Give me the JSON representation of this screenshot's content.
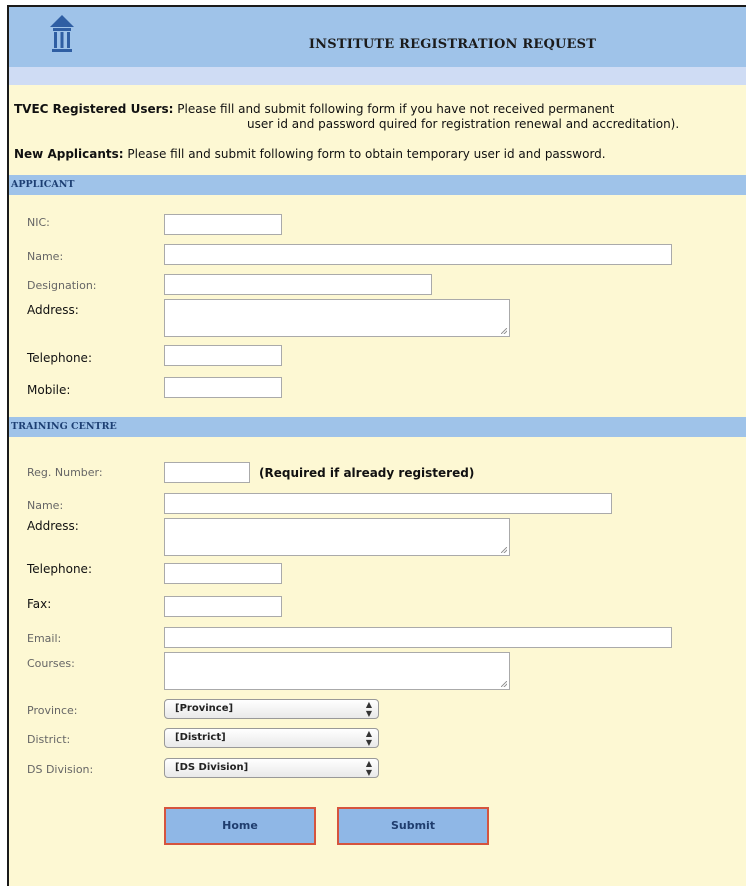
{
  "header": {
    "title": "INSTITUTE REGISTRATION REQUEST",
    "logo": "building-icon"
  },
  "intro": {
    "registered_label": "TVEC Registered Users:",
    "registered_text": "Please fill and submit following form if you have not received permanent",
    "registered_text_cont": "user id and password quired for registration renewal and accreditation).",
    "new_label": "New Applicants:",
    "new_text": "Please fill and submit following form to obtain temporary user id and password."
  },
  "applicant": {
    "section_title": "APPLICANT",
    "nic_label": "NIC:",
    "name_label": "Name:",
    "designation_label": "Designation:",
    "address_label": "Address:",
    "telephone_label": "Telephone:",
    "mobile_label": "Mobile:"
  },
  "centre": {
    "section_title": "TRAINING CENTRE",
    "reg_label": "Reg. Number:",
    "reg_note": "(Required if already registered)",
    "name_label": "Name:",
    "address_label": "Address:",
    "telephone_label": "Telephone:",
    "fax_label": "Fax:",
    "email_label": "Email:",
    "courses_label": "Courses:",
    "province_label": "Province:",
    "province_value": "[Province]",
    "district_label": "District:",
    "district_value": "[District]",
    "ds_label": "DS Division:",
    "ds_value": "[DS Division]"
  },
  "buttons": {
    "home": "Home",
    "submit": "Submit"
  }
}
